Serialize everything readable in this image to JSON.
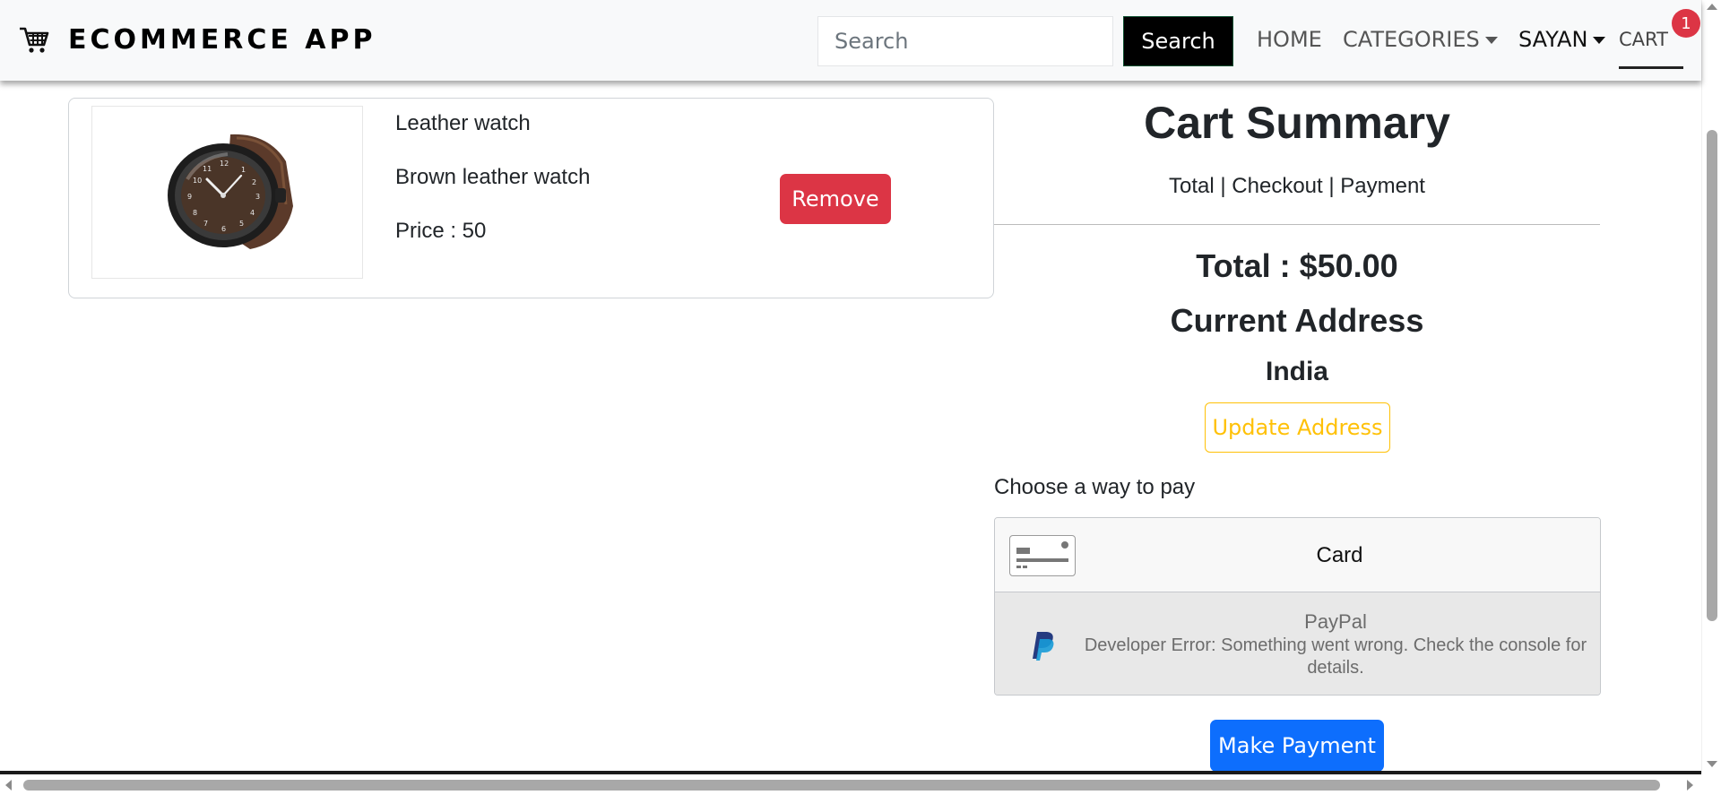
{
  "navbar": {
    "brand": "ECOMMERCE APP",
    "brand_icon": "shopping-cart-icon",
    "search_placeholder": "Search",
    "search_button": "Search",
    "links": {
      "home": "HOME",
      "categories": "CATEGORIES",
      "user": "SAYAN",
      "cart": "CART"
    },
    "cart_count": "1"
  },
  "cart_items": [
    {
      "name": "Leather watch",
      "description": "Brown leather watch",
      "price": "Price : 50",
      "remove_label": "Remove",
      "image": "brown-leather-watch"
    }
  ],
  "summary": {
    "title": "Cart Summary",
    "subtitle": "Total | Checkout | Payment",
    "total": "Total : $50.00",
    "address_title": "Current Address",
    "address_value": "India",
    "update_address": "Update Address",
    "choose_pay": "Choose a way to pay",
    "pay_options": {
      "card": "Card",
      "paypal": "PayPal",
      "paypal_error": "Developer Error: Something went wrong. Check the console for details."
    },
    "make_payment": "Make Payment"
  },
  "colors": {
    "danger": "#dc3545",
    "warning": "#ffc107",
    "primary": "#0d6efd",
    "navbar_bg": "#f8f9fa"
  }
}
